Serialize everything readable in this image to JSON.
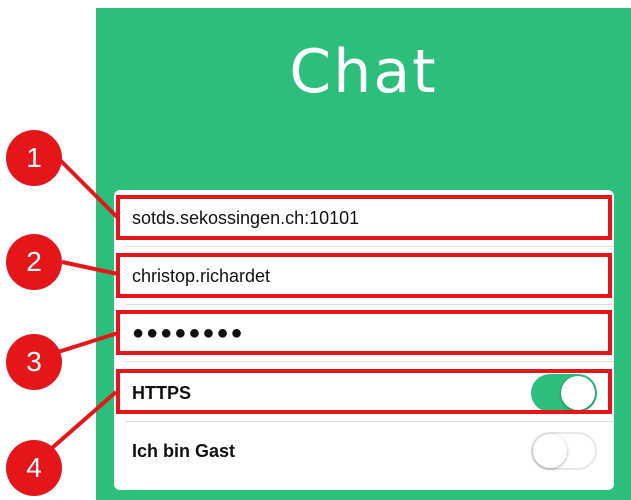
{
  "app": {
    "title": "Chat"
  },
  "form": {
    "server": "sotds.sekossingen.ch:10101",
    "username": "christop.richardet",
    "password_mask": "●●●●●●●●",
    "https_label": "HTTPS",
    "https_on": true,
    "guest_label": "Ich bin Gast",
    "guest_on": false
  },
  "callouts": [
    "1",
    "2",
    "3",
    "4"
  ],
  "colors": {
    "brand": "#2cbf7c",
    "highlight": "#e4161a"
  }
}
